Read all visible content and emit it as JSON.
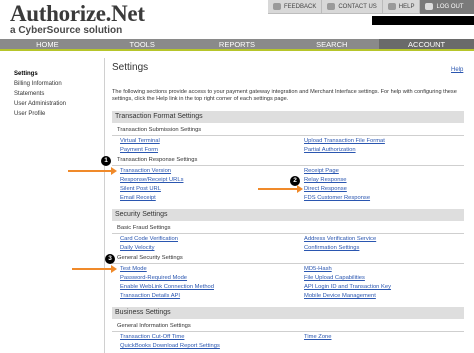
{
  "logo": {
    "title": "Authorize.Net",
    "subtitle": "a CyberSource solution"
  },
  "utility": {
    "feedback": "FEEDBACK",
    "contact": "CONTACT US",
    "help": "HELP",
    "logout": "LOG OUT"
  },
  "nav": {
    "home": "HOME",
    "tools": "TOOLS",
    "reports": "REPORTS",
    "search": "SEARCH",
    "account": "ACCOUNT"
  },
  "sidebar": {
    "items": [
      {
        "label": "Settings"
      },
      {
        "label": "Billing Information"
      },
      {
        "label": "Statements"
      },
      {
        "label": "User Administration"
      },
      {
        "label": "User Profile"
      }
    ]
  },
  "main": {
    "title": "Settings",
    "help_link": "Help",
    "intro": "The following sections provide access to your payment gateway integration and Merchant Interface settings. For help with configuring these settings, click the Help link in the top right corner of each settings page."
  },
  "sections": {
    "transaction_format": {
      "title": "Transaction Format Settings",
      "submission": {
        "title": "Transaction Submission Settings",
        "links": [
          "Virtual Terminal",
          "Upload Transaction File Format",
          "Payment Form",
          "Partial Authorization"
        ]
      },
      "response": {
        "title": "Transaction Response Settings",
        "links": [
          "Transaction Version",
          "Receipt Page",
          "Response/Receipt URLs",
          "Relay Response",
          "Silent Post URL",
          "Direct Response",
          "Email Receipt",
          "FDS Customer Response"
        ]
      }
    },
    "security": {
      "title": "Security Settings",
      "fraud": {
        "title": "Basic Fraud Settings",
        "links": [
          "Card Code Verification",
          "Address Verification Service",
          "Daily Velocity",
          "Confirmation Settings"
        ]
      },
      "general": {
        "title": "General Security Settings",
        "links": [
          "Test Mode",
          "MD5-Hash",
          "Password-Required Mode",
          "File Upload Capabilities",
          "Enable WebLink Connection Method",
          "API Login ID and Transaction Key",
          "Transaction Details API",
          "Mobile Device Management"
        ]
      }
    },
    "business": {
      "title": "Business Settings",
      "info": {
        "title": "General Information Settings",
        "links": [
          "Transaction Cut-Off Time",
          "Time Zone",
          "QuickBooks Download Report Settings"
        ]
      }
    }
  },
  "callouts": [
    "1",
    "2",
    "3"
  ],
  "colors": {
    "nav_bg": "#8a8a8a",
    "nav_accent": "#b6c52a",
    "link": "#2a56b0",
    "arrow": "#f08a2a"
  }
}
